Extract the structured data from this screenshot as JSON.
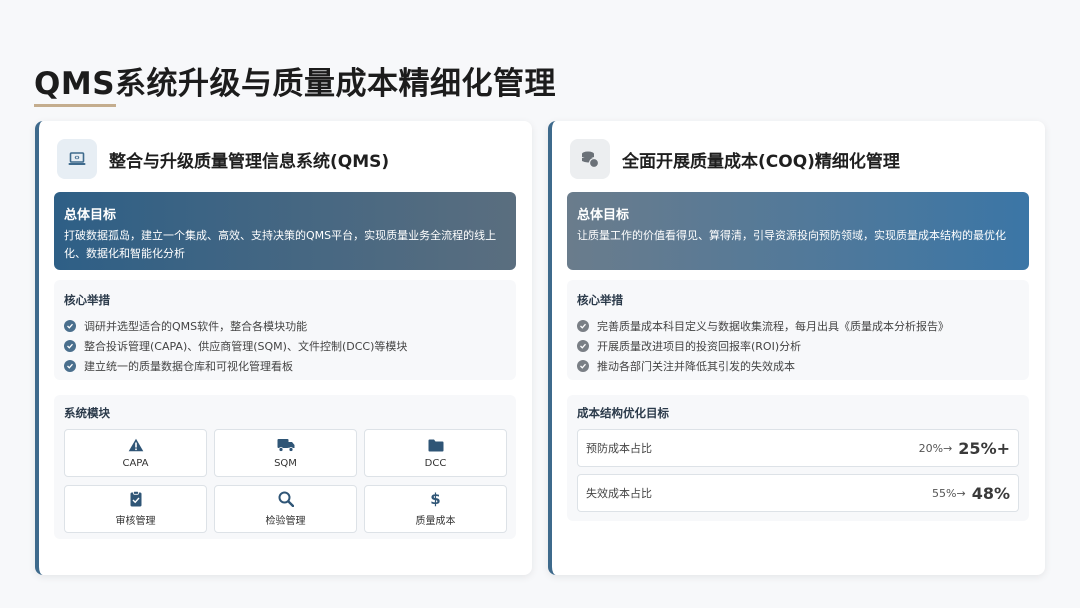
{
  "page": {
    "title": "QMS系统升级与质量成本精细化管理"
  },
  "left_card": {
    "title": "整合与升级质量管理信息系统(QMS)",
    "icon": "laptop-icon",
    "goal": {
      "title": "总体目标",
      "text": "打破数据孤岛，建立一个集成、高效、支持决策的QMS平台，实现质量业务全流程的线上化、数据化和智能化分析"
    },
    "measures": {
      "title": "核心举措",
      "items": [
        "调研并选型适合的QMS软件，整合各模块功能",
        "整合投诉管理(CAPA)、供应商管理(SQM)、文件控制(DCC)等模块",
        "建立统一的质量数据仓库和可视化管理看板"
      ]
    },
    "modules": {
      "title": "系统模块",
      "items": [
        {
          "label": "CAPA",
          "icon": "warning-icon"
        },
        {
          "label": "SQM",
          "icon": "truck-icon"
        },
        {
          "label": "DCC",
          "icon": "folder-icon"
        },
        {
          "label": "审核管理",
          "icon": "clipboard-check-icon"
        },
        {
          "label": "检验管理",
          "icon": "search-icon"
        },
        {
          "label": "质量成本",
          "icon": "dollar-icon"
        }
      ]
    }
  },
  "right_card": {
    "title": "全面开展质量成本(COQ)精细化管理",
    "icon": "coins-icon",
    "goal": {
      "title": "总体目标",
      "text": "让质量工作的价值看得见、算得清，引导资源投向预防领域，实现质量成本结构的最优化"
    },
    "measures": {
      "title": "核心举措",
      "items": [
        "完善质量成本科目定义与数据收集流程，每月出具《质量成本分析报告》",
        "开展质量改进项目的投资回报率(ROI)分析",
        "推动各部门关注并降低其引发的失效成本"
      ]
    },
    "cost_targets": {
      "title": "成本结构优化目标",
      "rows": [
        {
          "label": "预防成本占比",
          "from": "20%→",
          "to": "25%+"
        },
        {
          "label": "失效成本占比",
          "from": "55%→",
          "to": "48%"
        }
      ]
    }
  },
  "colors": {
    "accent": "#3e6a8c",
    "underline": "#c4ad8e"
  }
}
